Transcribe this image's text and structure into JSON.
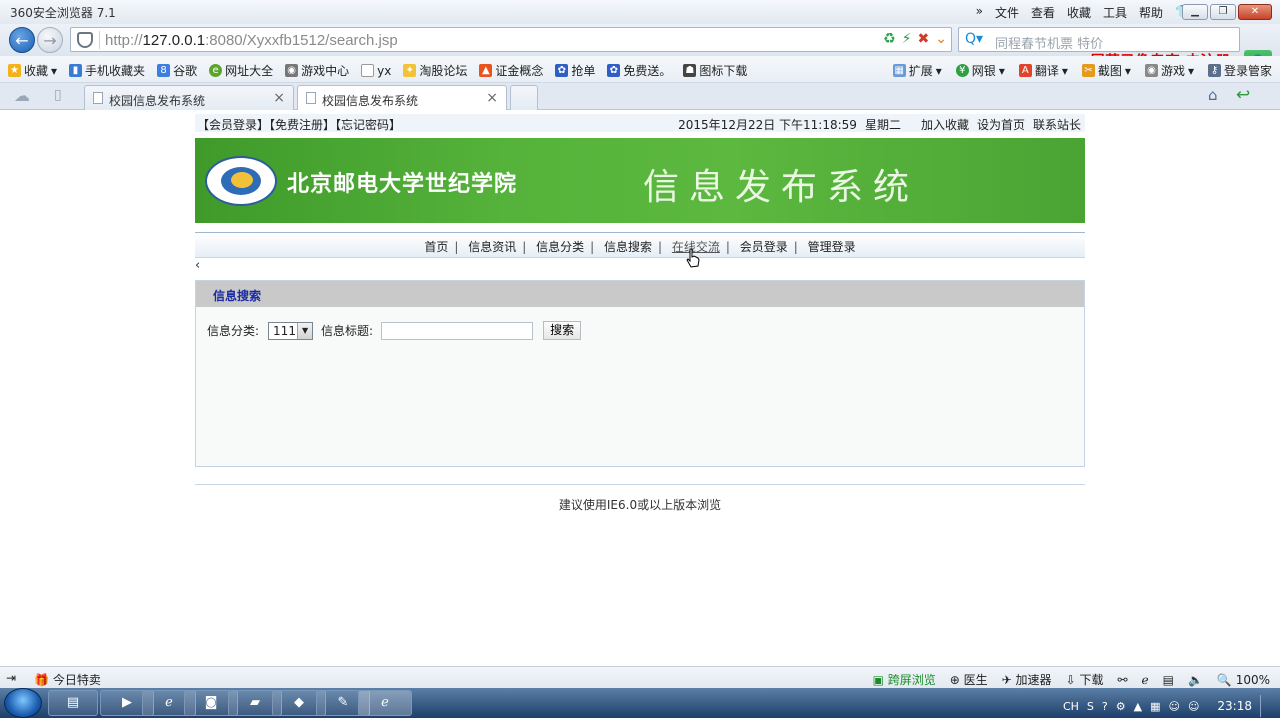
{
  "browser": {
    "window_title": "360安全浏览器 7.1",
    "menu": [
      "»",
      "文件",
      "查看",
      "收藏",
      "工具",
      "帮助"
    ],
    "url_prefix": "http://",
    "url_host": "127.0.0.1",
    "url_rest": ":8080/Xyxxfb1512/search.jsp",
    "search_placeholder": "同程春节机票  特价",
    "recorder_watermark": "屏幕录像专家  未注册",
    "favorites_left": [
      "收藏",
      "手机收藏夹",
      "谷歌",
      "网址大全",
      "游戏中心",
      "yx",
      "淘股论坛",
      "证金概念",
      "抢单",
      "免费送。",
      "图标下载"
    ],
    "favorites_right": [
      "扩展",
      "网银",
      "翻译",
      "截图",
      "游戏",
      "登录管家"
    ],
    "tabs": [
      {
        "label": "校园信息发布系统"
      },
      {
        "label": "校园信息发布系统"
      }
    ],
    "status_left": [
      "今日特卖"
    ],
    "status_right": [
      "跨屏浏览",
      "医生",
      "加速器",
      "下载",
      "100%"
    ]
  },
  "site": {
    "top_links": "【会员登录】【免费注册】【忘记密码】",
    "datetime": "2015年12月22日  下午11:18:59",
    "weekday": "星期二",
    "right_links": [
      "加入收藏",
      "设为首页",
      "联系站长"
    ],
    "school_name": "北京邮电大学世纪学院",
    "system_name": "信息发布系统",
    "nav": [
      "首页",
      "信息资讯",
      "信息分类",
      "信息搜索",
      "在线交流",
      "会员登录",
      "管理登录"
    ],
    "back_arrow": "‹",
    "panel_title": "信息搜索",
    "form": {
      "category_label": "信息分类:",
      "category_value": "111",
      "title_label": "信息标题:",
      "title_value": "",
      "search_button": "搜索"
    },
    "footer": "建议使用IE6.0或以上版本浏览"
  },
  "taskbar": {
    "lang": "CH",
    "clock": "23:18"
  }
}
